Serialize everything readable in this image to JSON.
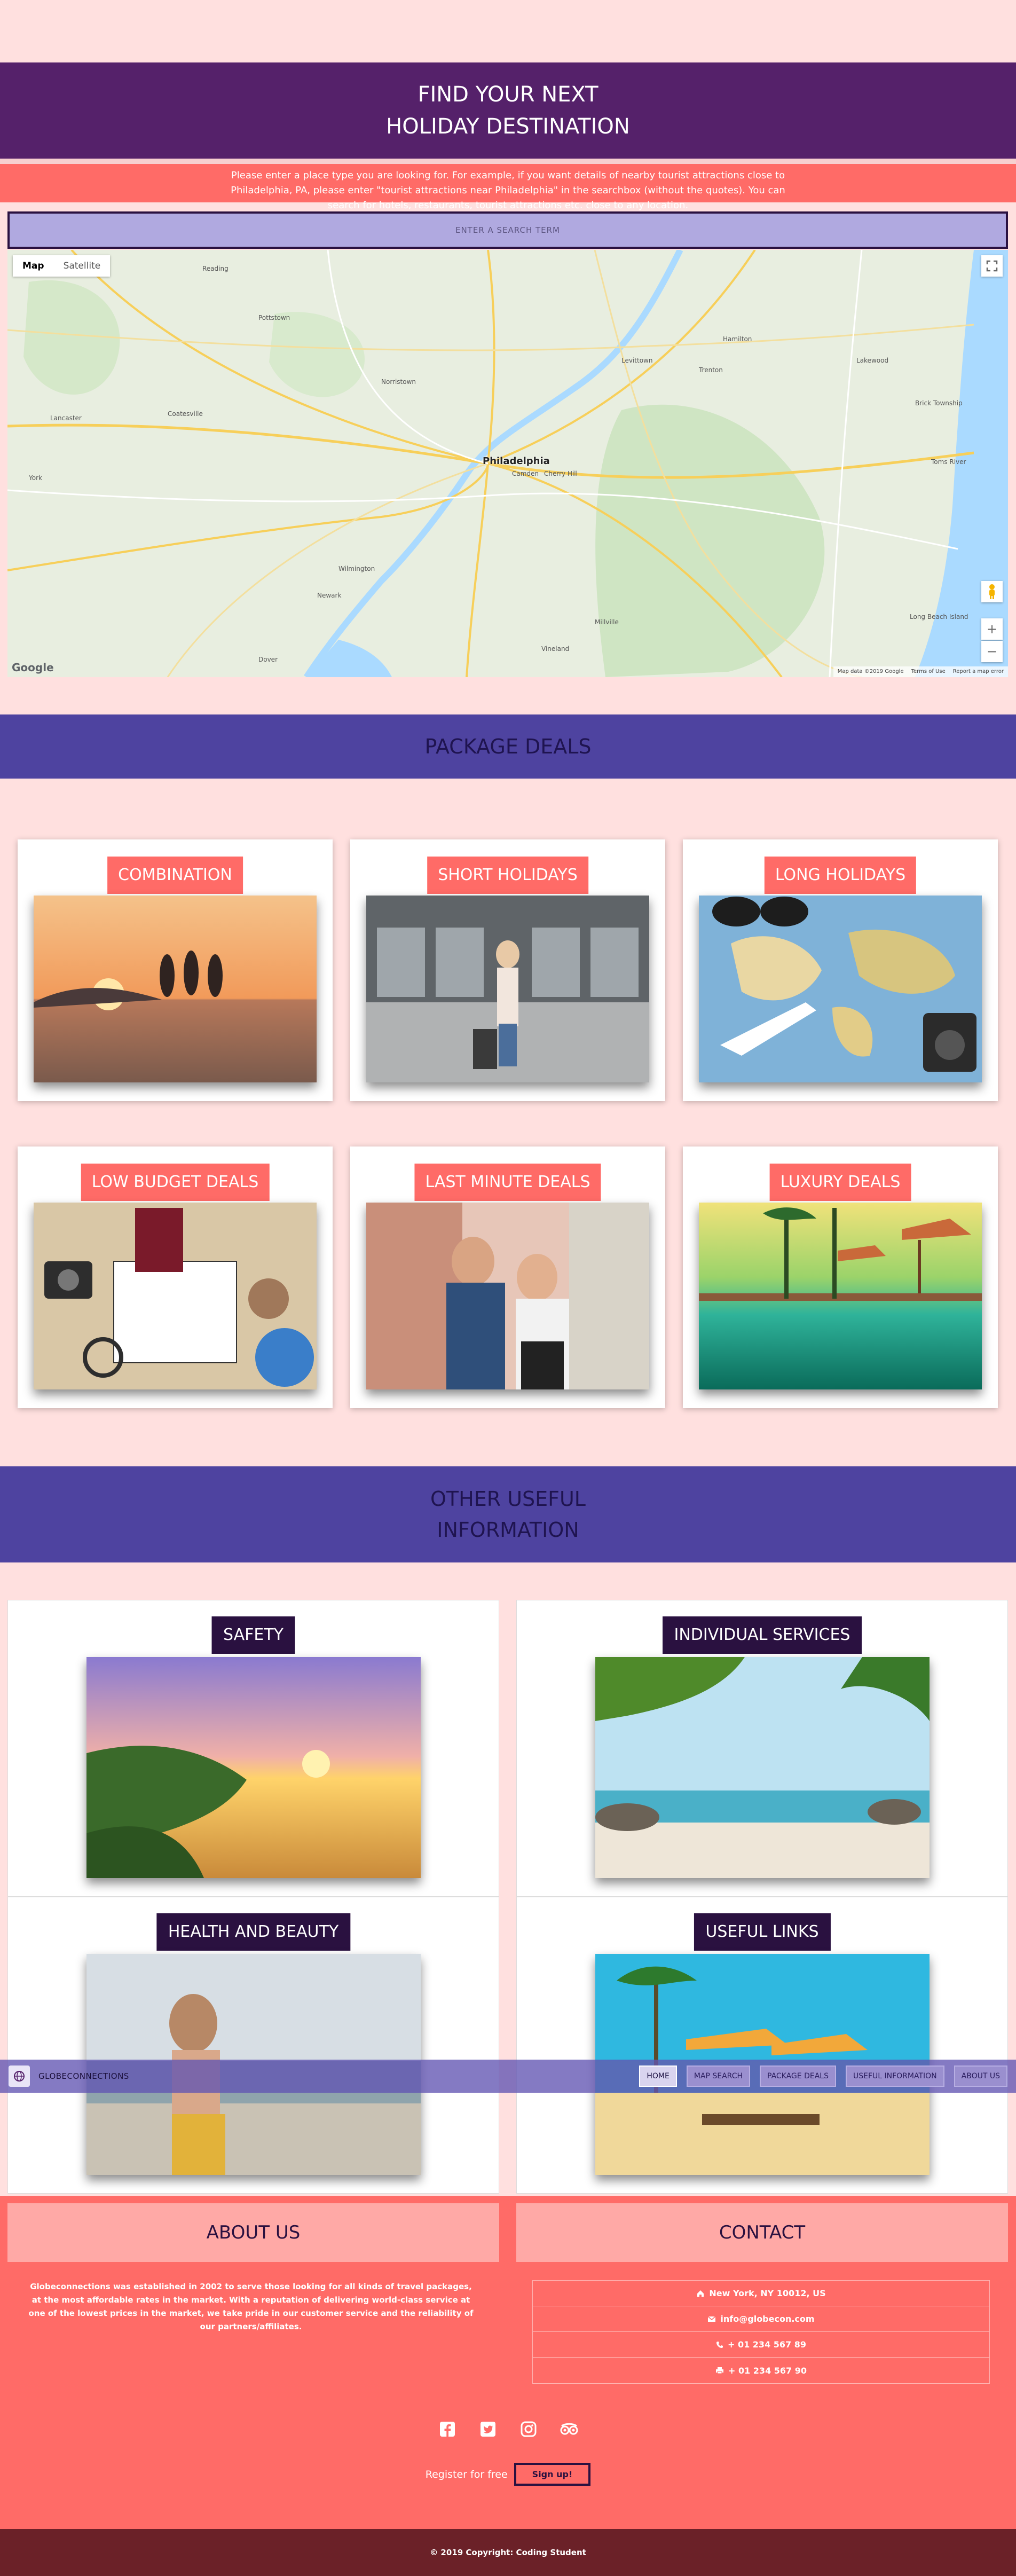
{
  "hero": {
    "title_line1": "FIND YOUR NEXT",
    "title_line2": "HOLIDAY DESTINATION"
  },
  "intro_text": "Please enter a place type you are looking for. For example, if you want details of nearby tourist attractions close to Philadelphia, PA, please enter \"tourist attractions near Philadelphia\" in the searchbox (without the quotes). You can search for hotels, restaurants, tourist attractions etc. close to any location.",
  "search": {
    "placeholder": "ENTER A SEARCH TERM"
  },
  "map": {
    "tab_map": "Map",
    "tab_satellite": "Satellite",
    "center_label": "Philadelphia",
    "towns": [
      "Reading",
      "Trenton",
      "Lancaster",
      "Wilmington",
      "Camden",
      "Cherry Hill",
      "Levittown",
      "Toms River",
      "Long Beach Island",
      "Vineland",
      "Norristown",
      "Dover",
      "Newark",
      "York",
      "Brick Township",
      "Hamilton",
      "Lakewood",
      "Pottstown",
      "Coatesville",
      "Millville"
    ],
    "credits": [
      "Map data ©2019 Google",
      "Terms of Use",
      "Report a map error"
    ],
    "logo": "Google"
  },
  "packages": {
    "heading": "PACKAGE DEALS",
    "items": [
      {
        "title": "COMBINATION"
      },
      {
        "title": "SHORT HOLIDAYS"
      },
      {
        "title": "LONG HOLIDAYS"
      },
      {
        "title": "LOW BUDGET DEALS"
      },
      {
        "title": "LAST MINUTE DEALS"
      },
      {
        "title": "LUXURY DEALS"
      }
    ]
  },
  "info": {
    "heading_line1": "OTHER USEFUL",
    "heading_line2": "INFORMATION",
    "items": [
      {
        "title": "SAFETY"
      },
      {
        "title": "INDIVIDUAL SERVICES"
      },
      {
        "title": "HEALTH AND BEAUTY"
      },
      {
        "title": "USEFUL LINKS"
      }
    ]
  },
  "navbar": {
    "brand": "GLOBECONNECTIONS",
    "links": [
      "HOME",
      "MAP SEARCH",
      "PACKAGE DEALS",
      "USEFUL INFORMATION",
      "ABOUT US"
    ]
  },
  "footer": {
    "about_title": "ABOUT US",
    "about_text": "Globeconnections was established in 2002 to serve those looking for all kinds of travel packages, at the most affordable rates in the market. With a reputation of delivering world-class service at one of the lowest prices in the market, we take pride in our customer service and the reliability of our partners/affiliates.",
    "contact_title": "CONTACT",
    "contact": {
      "address": "New York, NY 10012, US",
      "email": "info@globecon.com",
      "phone": "+ 01 234 567 89",
      "fax": "+ 01 234 567 90"
    },
    "register_text": "Register for free",
    "signup_label": "Sign up!",
    "copyright": "© 2019 Copyright: Coding Student"
  },
  "colors": {
    "page_bg": "#ffe0df",
    "hero_bg": "#55216a",
    "coral": "#ff6b67",
    "banner_bg": "#4e43a0",
    "dark_purple": "#2a1140",
    "copyright_bg": "#6b2128"
  }
}
